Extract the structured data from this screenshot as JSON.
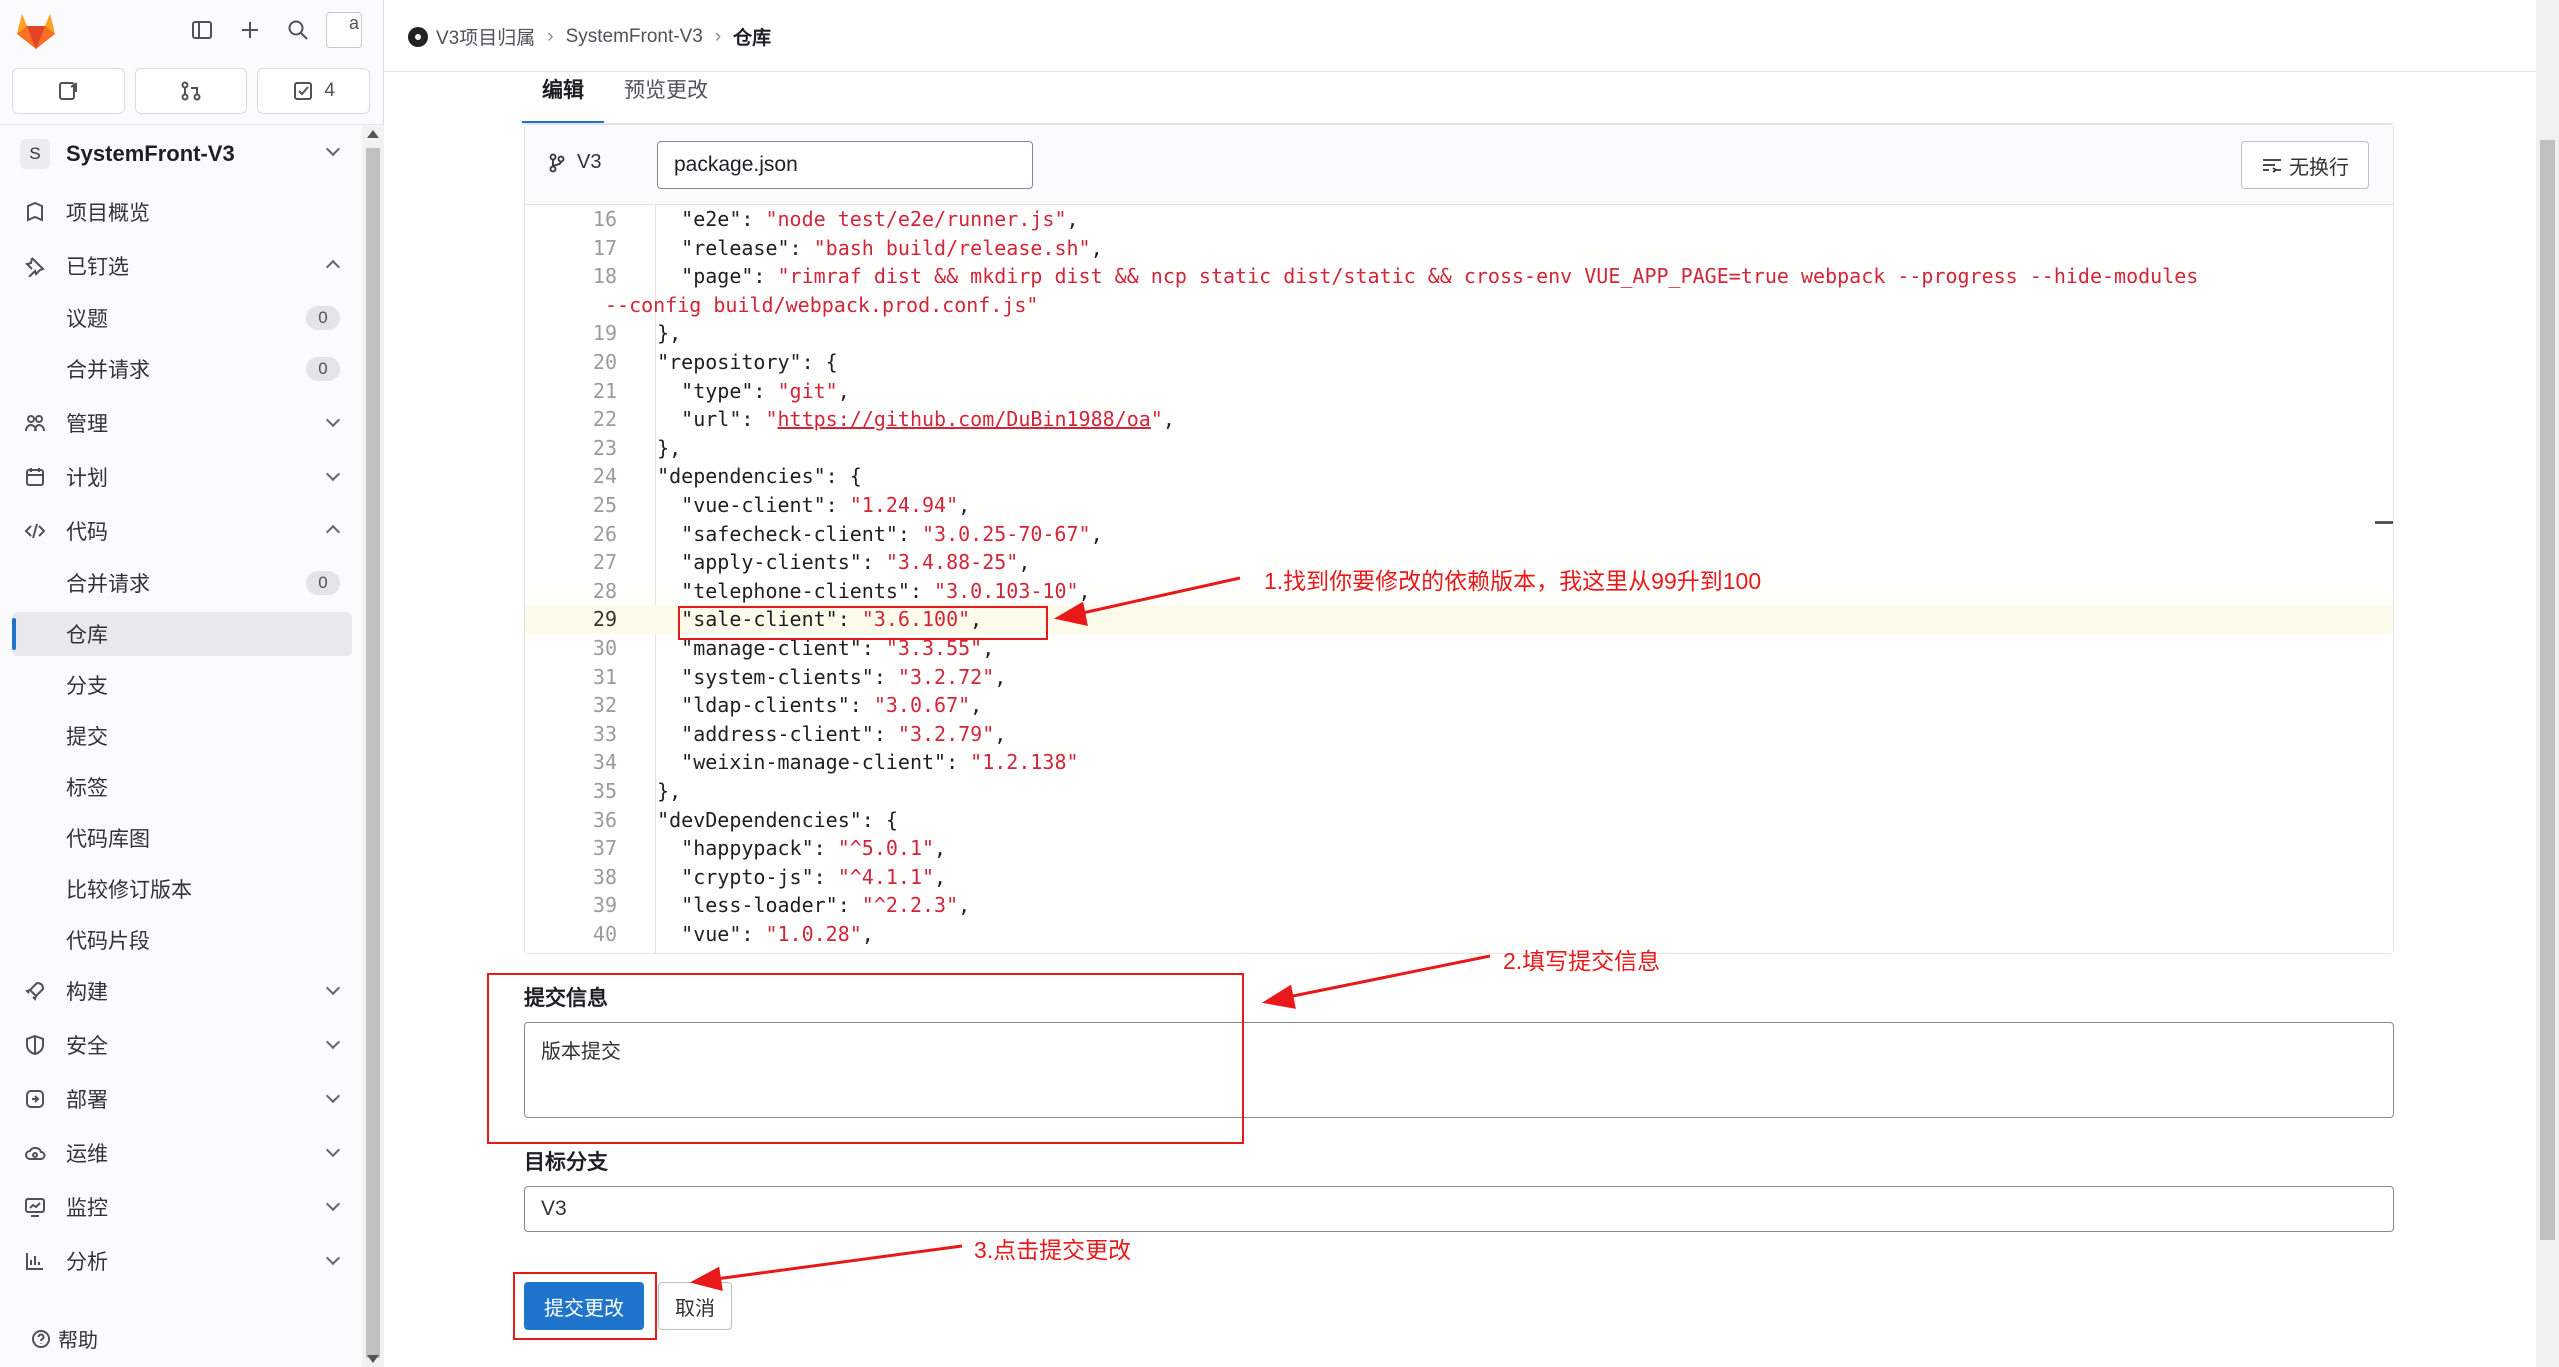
{
  "sidebar": {
    "avatar_alt": "a",
    "buttons": [
      {
        "name": "issues-shortcut",
        "label": ""
      },
      {
        "name": "merge-requests-shortcut",
        "label": ""
      },
      {
        "name": "todos-shortcut",
        "label": "4"
      }
    ],
    "project": {
      "badge": "S",
      "name": "SystemFront-V3"
    },
    "items": {
      "overview": "项目概览",
      "pinned": "已钉选",
      "pinned_issues": {
        "label": "议题",
        "count": "0"
      },
      "pinned_mrs": {
        "label": "合并请求",
        "count": "0"
      },
      "manage": "管理",
      "plan": "计划",
      "code": "代码",
      "code_mrs": {
        "label": "合并请求",
        "count": "0"
      },
      "repository": "仓库",
      "branches": "分支",
      "commits": "提交",
      "tags": "标签",
      "repo_graph": "代码库图",
      "compare": "比较修订版本",
      "snippets": "代码片段",
      "build": "构建",
      "secure": "安全",
      "deploy": "部署",
      "operate": "运维",
      "monitor": "监控",
      "analyze": "分析"
    },
    "help": "帮助"
  },
  "breadcrumbs": [
    "V3项目归属",
    "SystemFront-V3",
    "仓库"
  ],
  "tabs": {
    "edit": "编辑",
    "preview": "预览更改"
  },
  "editor": {
    "branch": "V3",
    "filename": "package.json",
    "nowrap_label": "无换行",
    "lines": [
      {
        "n": "16",
        "parts": [
          [
            "k",
            "    \""
          ],
          [
            "k",
            "e2e"
          ],
          [
            "k",
            "\": "
          ],
          [
            "s",
            "\"node test/e2e/runner.js\""
          ],
          [
            "k",
            ","
          ]
        ]
      },
      {
        "n": "17",
        "parts": [
          [
            "k",
            "    \"release\": "
          ],
          [
            "s",
            "\"bash build/release.sh\""
          ],
          [
            "k",
            ","
          ]
        ]
      },
      {
        "n": "18",
        "parts": [
          [
            "k",
            "    \"page\": "
          ],
          [
            "s",
            "\"rimraf dist && mkdirp dist && ncp static dist/static && cross-env VUE_APP_PAGE=true webpack --progress --hide-modules"
          ]
        ]
      },
      {
        "n": "",
        "parts": [
          [
            "s",
            "--config build/webpack.prod.conf.js\""
          ]
        ],
        "wrap": true
      },
      {
        "n": "19",
        "parts": [
          [
            "k",
            "  },"
          ]
        ]
      },
      {
        "n": "20",
        "parts": [
          [
            "k",
            "  \"repository\": {"
          ]
        ]
      },
      {
        "n": "21",
        "parts": [
          [
            "k",
            "    \"type\": "
          ],
          [
            "s",
            "\"git\""
          ],
          [
            "k",
            ","
          ]
        ]
      },
      {
        "n": "22",
        "parts": [
          [
            "k",
            "    \"url\": "
          ],
          [
            "s",
            "\""
          ],
          [
            "u",
            "https://github.com/DuBin1988/oa"
          ],
          [
            "s",
            "\""
          ],
          [
            "k",
            ","
          ]
        ]
      },
      {
        "n": "23",
        "parts": [
          [
            "k",
            "  },"
          ]
        ]
      },
      {
        "n": "24",
        "parts": [
          [
            "k",
            "  \"dependencies\": {"
          ]
        ]
      },
      {
        "n": "25",
        "parts": [
          [
            "k",
            "    \"vue-client\": "
          ],
          [
            "s",
            "\"1.24.94\""
          ],
          [
            "k",
            ","
          ]
        ]
      },
      {
        "n": "26",
        "parts": [
          [
            "k",
            "    \"safecheck-client\": "
          ],
          [
            "s",
            "\"3.0.25-70-67\""
          ],
          [
            "k",
            ","
          ]
        ]
      },
      {
        "n": "27",
        "parts": [
          [
            "k",
            "    \"apply-clients\": "
          ],
          [
            "s",
            "\"3.4.88-25\""
          ],
          [
            "k",
            ","
          ]
        ]
      },
      {
        "n": "28",
        "parts": [
          [
            "k",
            "    \"telephone-clients\": "
          ],
          [
            "s",
            "\"3.0.103-10\""
          ],
          [
            "k",
            ","
          ]
        ]
      },
      {
        "n": "29",
        "parts": [
          [
            "k",
            "    \"sale-client\": "
          ],
          [
            "s",
            "\"3.6.100\""
          ],
          [
            "k",
            ","
          ]
        ],
        "current": true
      },
      {
        "n": "30",
        "parts": [
          [
            "k",
            "    \"manage-client\": "
          ],
          [
            "s",
            "\"3.3.55\""
          ],
          [
            "k",
            ","
          ]
        ]
      },
      {
        "n": "31",
        "parts": [
          [
            "k",
            "    \"system-clients\": "
          ],
          [
            "s",
            "\"3.2.72\""
          ],
          [
            "k",
            ","
          ]
        ]
      },
      {
        "n": "32",
        "parts": [
          [
            "k",
            "    \"ldap-clients\": "
          ],
          [
            "s",
            "\"3.0.67\""
          ],
          [
            "k",
            ","
          ]
        ]
      },
      {
        "n": "33",
        "parts": [
          [
            "k",
            "    \"address-client\": "
          ],
          [
            "s",
            "\"3.2.79\""
          ],
          [
            "k",
            ","
          ]
        ]
      },
      {
        "n": "34",
        "parts": [
          [
            "k",
            "    \"weixin-manage-client\": "
          ],
          [
            "s",
            "\"1.2.138\""
          ]
        ]
      },
      {
        "n": "35",
        "parts": [
          [
            "k",
            "  },"
          ]
        ]
      },
      {
        "n": "36",
        "parts": [
          [
            "k",
            "  \"devDependencies\": {"
          ]
        ]
      },
      {
        "n": "37",
        "parts": [
          [
            "k",
            "    \"happypack\": "
          ],
          [
            "s",
            "\"^5.0.1\""
          ],
          [
            "k",
            ","
          ]
        ]
      },
      {
        "n": "38",
        "parts": [
          [
            "k",
            "    \"crypto-js\": "
          ],
          [
            "s",
            "\"^4.1.1\""
          ],
          [
            "k",
            ","
          ]
        ]
      },
      {
        "n": "39",
        "parts": [
          [
            "k",
            "    \"less-loader\": "
          ],
          [
            "s",
            "\"^2.2.3\""
          ],
          [
            "k",
            ","
          ]
        ]
      },
      {
        "n": "40",
        "parts": [
          [
            "k",
            "    \"vue\": "
          ],
          [
            "s",
            "\"1.0.28\""
          ],
          [
            "k",
            ","
          ]
        ]
      }
    ]
  },
  "form": {
    "commit_label": "提交信息",
    "commit_value": "版本提交",
    "branch_label": "目标分支",
    "branch_value": "V3",
    "submit": "提交更改",
    "cancel": "取消"
  },
  "annotations": {
    "step1": "1.找到你要修改的依赖版本，我这里从99升到100",
    "step2": "2.填写提交信息",
    "step3": "3.点击提交更改",
    "color": "#e8191a"
  }
}
